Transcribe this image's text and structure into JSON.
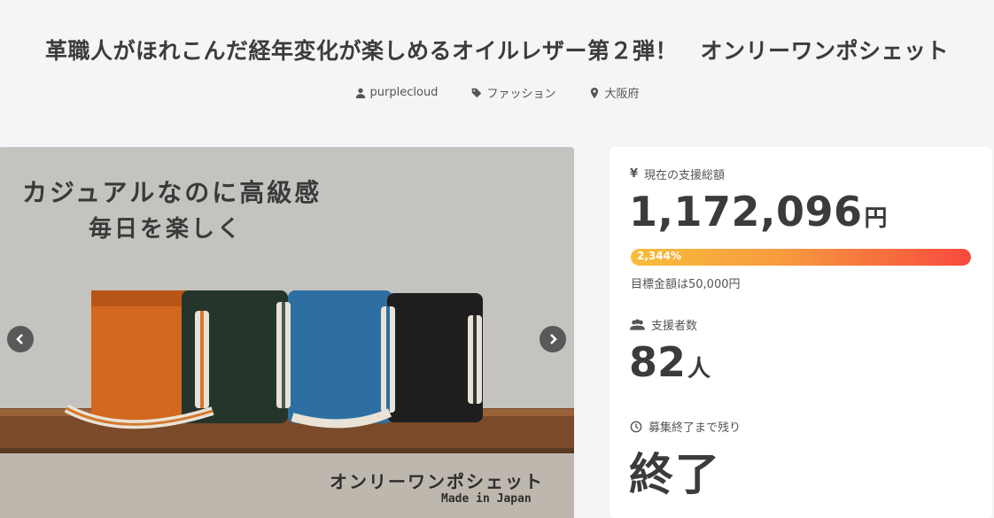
{
  "project": {
    "title": "革職人がほれこんだ経年変化が楽しめるオイルレザー第２弾！　オンリーワンポシェット",
    "owner": "purplecloud",
    "category": "ファッション",
    "location": "大阪府"
  },
  "carousel": {
    "overlay_line1": "カジュアルなのに高級感",
    "overlay_line2": "毎日を楽しく",
    "product_name": "オンリーワンポシェット",
    "made_in": "Made in Japan",
    "prev_icon": "chevron-left-icon",
    "next_icon": "chevron-right-icon"
  },
  "stats": {
    "total_label": "現在の支援総額",
    "total_icon": "yen-icon",
    "total_amount": "1,172,096",
    "total_unit": "円",
    "progress_text": "2,344%",
    "progress_fraction": 1.0,
    "goal_text": "目標金額は50,000円",
    "backers_label": "支援者数",
    "backers_icon": "users-icon",
    "backers_count": "82",
    "backers_unit": "人",
    "remaining_label": "募集終了まで残り",
    "remaining_icon": "clock-icon",
    "remaining_value": "終了"
  },
  "colors": {
    "progress_start": "#f7be3b",
    "progress_end": "#f7493f",
    "background": "#f4f5f7"
  }
}
